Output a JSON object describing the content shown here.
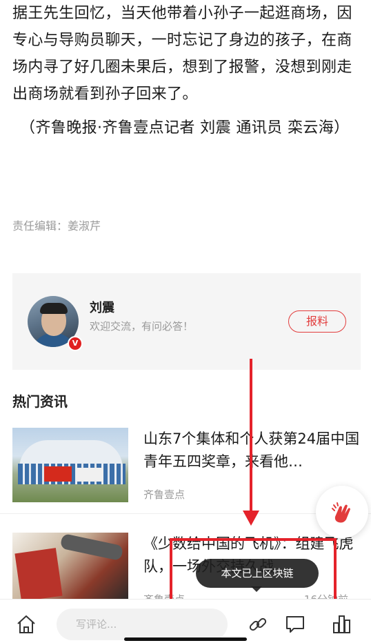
{
  "article": {
    "paragraph1": "据王先生回忆，当天他带着小孙子一起逛商场，因专心与导购员聊天，一时忘记了身边的孩子，在商场内寻了好几圈未果后，想到了报警，没想到刚走出商场就看到孙子回来了。",
    "credit": "（齐鲁晚报·齐鲁壹点记者 刘震 通讯员 栾云海）",
    "editor": "责任编辑：姜淑芹"
  },
  "author_card": {
    "name": "刘震",
    "motto": "欢迎交流，有问必答！",
    "badge": "V",
    "report_button": "报料"
  },
  "hot_news": {
    "section_title": "热门资讯",
    "items": [
      {
        "title": "山东7个集体和个人获第24届中国青年五四奖章，来看他…",
        "source": "齐鲁壹点"
      },
      {
        "title": "《少数给中国的飞机》：组建飞虎队，一场外交持久战",
        "source": "齐鲁壹点",
        "time": "16分钟前"
      }
    ]
  },
  "toast": {
    "text": "本文已上区块链"
  },
  "bottom_bar": {
    "comment_placeholder": "写评论..."
  },
  "icons": {
    "home": "home-icon",
    "link": "link-icon",
    "comment": "comment-icon",
    "stats": "bar-chart-icon",
    "clap": "clap-icon"
  },
  "colors": {
    "accent_red": "#e23b3b",
    "annotation_red": "#e4222a"
  }
}
